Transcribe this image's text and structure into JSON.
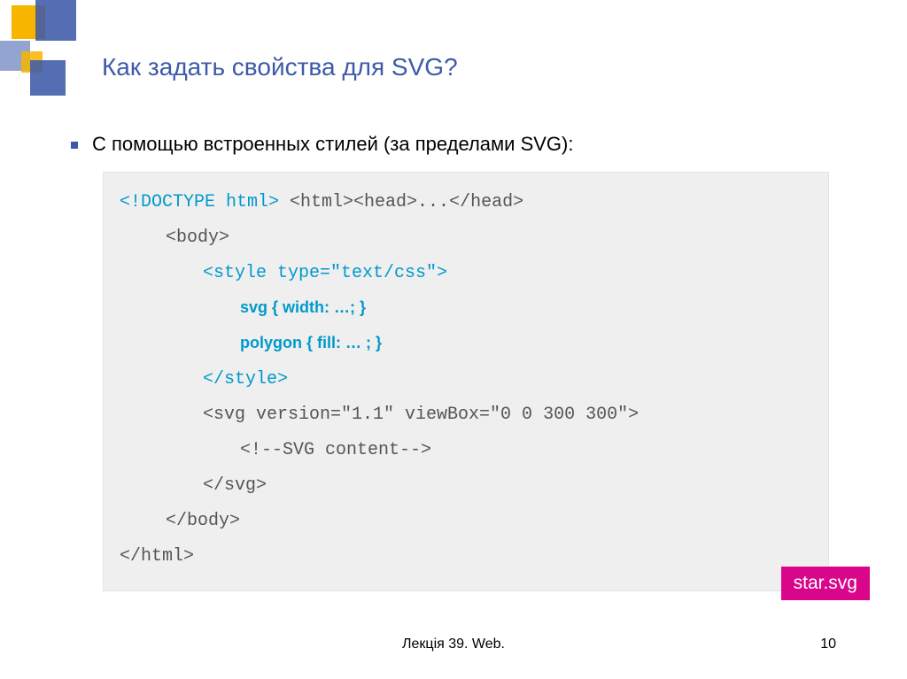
{
  "title": "Как задать свойства для SVG?",
  "bullet": "С помощью встроенных стилей (за пределами SVG):",
  "code": {
    "l1a": "<!DOCTYPE html>",
    "l1b": " <html><head>...</head>",
    "l2": "<body>",
    "l3": "<style type=\"text/css\">",
    "l4": "svg { width: …; }",
    "l5": "polygon { fill: … ; }",
    "l6": "</style>",
    "l7": "<svg version=\"1.1\" viewBox=\"0 0 300 300\">",
    "l8": "<!--SVG content-->",
    "l9": "</svg>",
    "l10": "</body>",
    "l11": "</html>"
  },
  "badge": "star.svg",
  "footer": "Лекція 39. Web.",
  "pagenum": "10"
}
